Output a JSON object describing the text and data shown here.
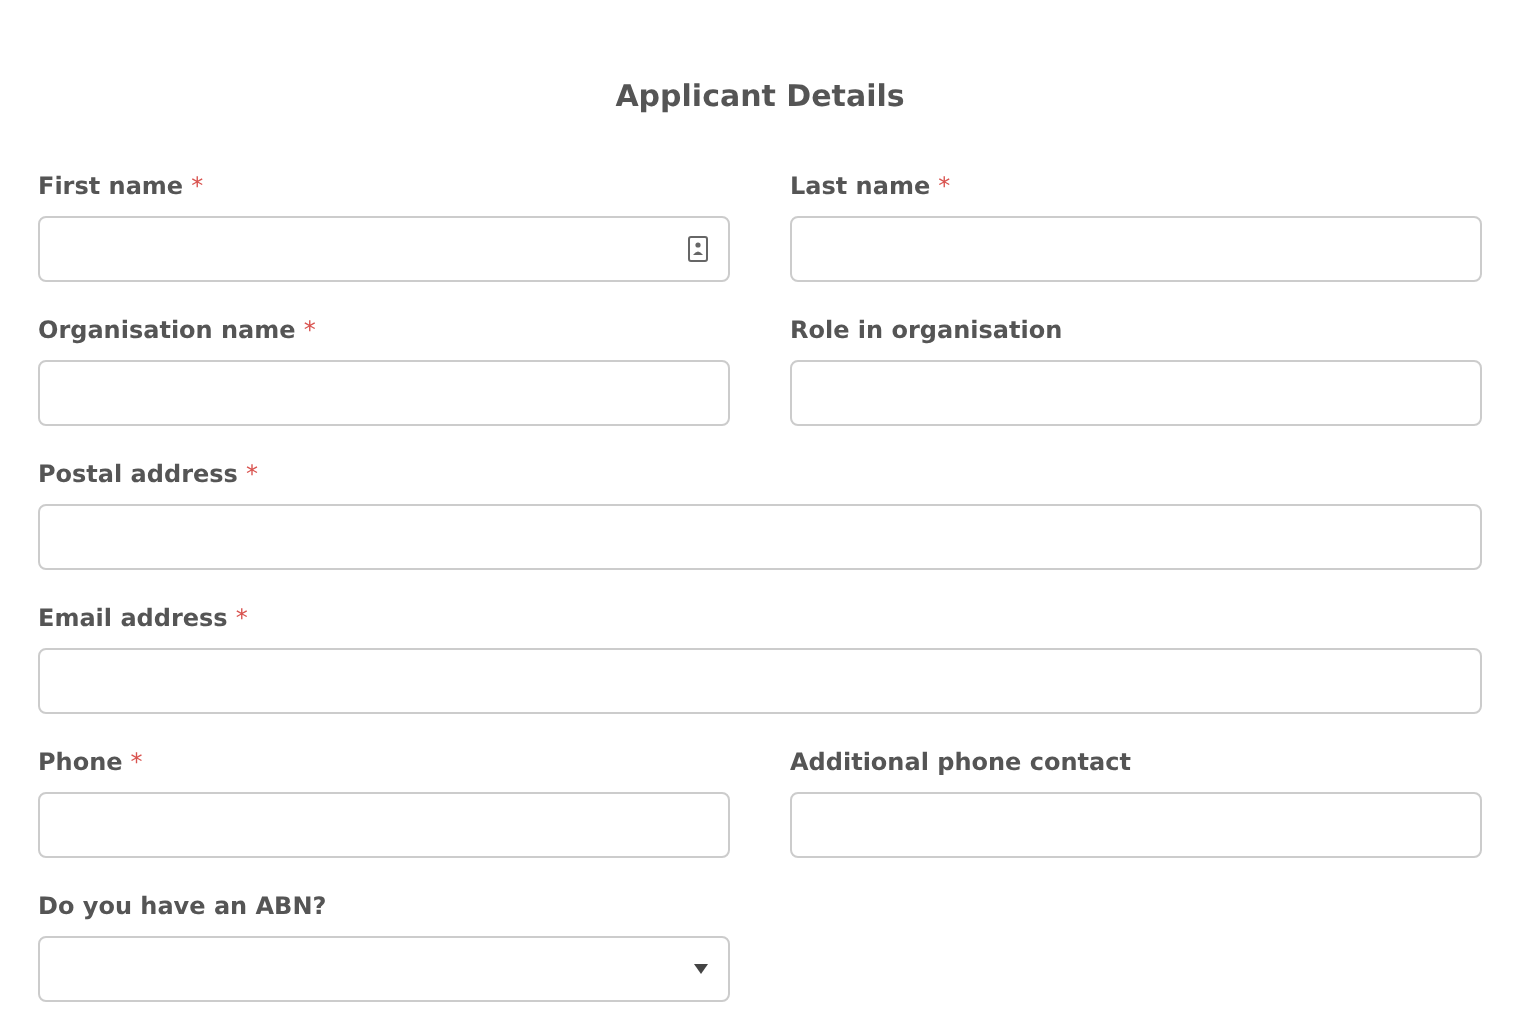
{
  "title": "Applicant Details",
  "required_mark": "*",
  "fields": [
    {
      "label": "First name",
      "required": true,
      "kind": "text",
      "autofill_icon": true
    },
    {
      "label": "Last name",
      "required": true,
      "kind": "text",
      "autofill_icon": false
    },
    {
      "label": "Organisation name",
      "required": true,
      "kind": "text",
      "autofill_icon": false
    },
    {
      "label": "Role in organisation",
      "required": false,
      "kind": "text",
      "autofill_icon": false
    },
    {
      "label": "Postal address",
      "required": true,
      "kind": "widetext",
      "autofill_icon": false
    },
    {
      "label": "Email address",
      "required": true,
      "kind": "widetext",
      "autofill_icon": false
    },
    {
      "label": "Phone",
      "required": true,
      "kind": "text",
      "autofill_icon": false
    },
    {
      "label": "Additional phone contact",
      "required": false,
      "kind": "text",
      "autofill_icon": false
    },
    {
      "label": "Do you have an ABN?",
      "required": false,
      "kind": "select",
      "autofill_icon": false
    }
  ]
}
